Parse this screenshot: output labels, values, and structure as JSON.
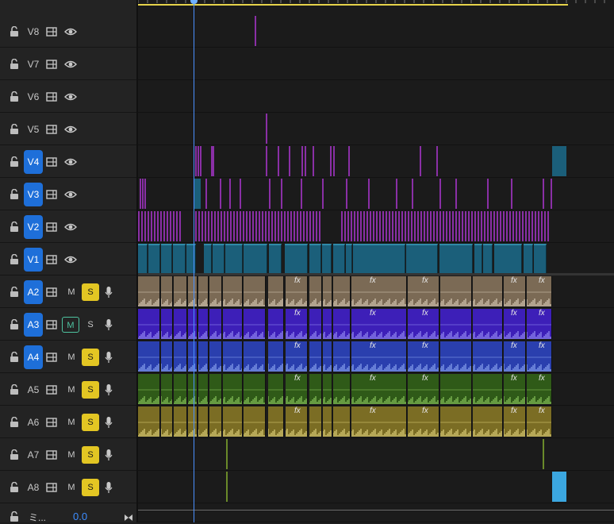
{
  "video_tracks": [
    {
      "name": "V8",
      "targeted": false
    },
    {
      "name": "V7",
      "targeted": false
    },
    {
      "name": "V6",
      "targeted": false
    },
    {
      "name": "V5",
      "targeted": false
    },
    {
      "name": "V4",
      "targeted": true
    },
    {
      "name": "V3",
      "targeted": true
    },
    {
      "name": "V2",
      "targeted": true
    },
    {
      "name": "V1",
      "targeted": true
    }
  ],
  "audio_tracks": [
    {
      "name": "A2",
      "targeted": true,
      "mute_label": "M",
      "solo_label": "S",
      "mute_active": false,
      "solo_on": true
    },
    {
      "name": "A3",
      "targeted": true,
      "mute_label": "M",
      "solo_label": "S",
      "mute_active": true,
      "solo_on": false
    },
    {
      "name": "A4",
      "targeted": true,
      "mute_label": "M",
      "solo_label": "S",
      "mute_active": false,
      "solo_on": true
    },
    {
      "name": "A5",
      "targeted": false,
      "mute_label": "M",
      "solo_label": "S",
      "mute_active": false,
      "solo_on": true
    },
    {
      "name": "A6",
      "targeted": false,
      "mute_label": "M",
      "solo_label": "S",
      "mute_active": false,
      "solo_on": true
    },
    {
      "name": "A7",
      "targeted": false,
      "mute_label": "M",
      "solo_label": "S",
      "mute_active": false,
      "solo_on": true
    },
    {
      "name": "A8",
      "targeted": false,
      "mute_label": "M",
      "solo_label": "S",
      "mute_active": false,
      "solo_on": true
    }
  ],
  "mix": {
    "name": "ミ...",
    "value": "0.0"
  },
  "fx_label": "fx",
  "colors": {
    "targeted": "#1e6fd9",
    "solo": "#e3c623",
    "mute_active": "#4ec3a0",
    "playhead": "#4a90ff",
    "work_area": "#e6d34a",
    "v1": "#1b5f7a",
    "v2_v3": "#8a2fa6",
    "a2": "#7b6a55",
    "a3": "#3d1fb8",
    "a4": "#2a3fae",
    "a5": "#2f5a18",
    "a6": "#7b6d24"
  }
}
